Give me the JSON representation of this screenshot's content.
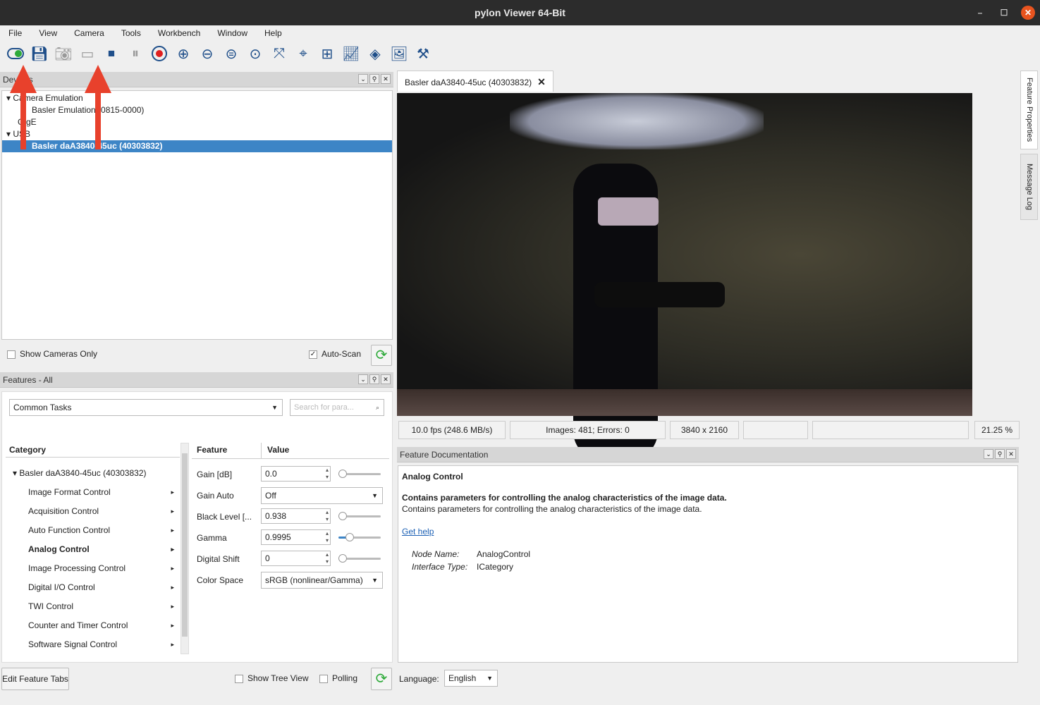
{
  "window": {
    "title": "pylon Viewer 64-Bit"
  },
  "menu": [
    "File",
    "View",
    "Camera",
    "Tools",
    "Workbench",
    "Window",
    "Help"
  ],
  "toolbar": [
    "open-camera",
    "save-features",
    "single-shot",
    "continuous-shot",
    "stop",
    "pause",
    "record",
    "zoom-in",
    "zoom-out",
    "zoom-fit",
    "zoom-100",
    "fit-window",
    "center",
    "grid",
    "histogram",
    "pixel-inspect",
    "image",
    "device-tools"
  ],
  "devices": {
    "title": "Devices",
    "tree": [
      {
        "label": "Camera Emulation",
        "level": 0,
        "expanded": true
      },
      {
        "label": "Basler Emulation (0815-0000)",
        "level": 1
      },
      {
        "label": "GigE",
        "level": 0
      },
      {
        "label": "USB",
        "level": 0,
        "expanded": true
      },
      {
        "label": "Basler daA3840-45uc (40303832)",
        "level": 1,
        "selected": true
      }
    ],
    "show_cameras_only": "Show Cameras Only",
    "auto_scan": "Auto-Scan",
    "auto_scan_checked": true
  },
  "features": {
    "title": "Features - All",
    "view_select": "Common Tasks",
    "search_placeholder": "Search for para...",
    "category_header": "Category",
    "feature_header": "Feature",
    "value_header": "Value",
    "root": "Basler daA3840-45uc (40303832)",
    "categories": [
      "Image Format Control",
      "Acquisition Control",
      "Auto Function Control",
      "Analog Control",
      "Image Processing Control",
      "Digital I/O Control",
      "TWI Control",
      "Counter and Timer Control",
      "Software Signal Control"
    ],
    "selected_category": "Analog Control",
    "rows": [
      {
        "name": "Gain [dB]",
        "value": "0.0",
        "type": "spin",
        "slider": 0.0
      },
      {
        "name": "Gain Auto",
        "value": "Off",
        "type": "combo"
      },
      {
        "name": "Black Level [...",
        "value": "0.938",
        "type": "spin",
        "slider": 0.0
      },
      {
        "name": "Gamma",
        "value": "0.9995",
        "type": "spin",
        "slider": 0.25
      },
      {
        "name": "Digital Shift",
        "value": "0",
        "type": "spin",
        "slider": 0.0
      },
      {
        "name": "Color Space",
        "value": "sRGB (nonlinear/Gamma)",
        "type": "combo"
      }
    ],
    "edit_tabs": "Edit Feature Tabs",
    "show_tree_view": "Show Tree View",
    "polling": "Polling"
  },
  "image_tab": {
    "label": "Basler daA3840-45uc (40303832)"
  },
  "status": {
    "fps": "10.0 fps (248.6 MB/s)",
    "images": "Images: 481; Errors: 0",
    "resolution": "3840 x 2160",
    "zoom": "21.25 %"
  },
  "doc": {
    "title": "Feature Documentation",
    "heading": "Analog Control",
    "summary": "Contains parameters for controlling the analog characteristics of the image data.",
    "description": "Contains parameters for controlling the analog characteristics of the image data.",
    "help_link": "Get help",
    "node_name_label": "Node Name:",
    "node_name": "AnalogControl",
    "interface_label": "Interface Type:",
    "interface": "ICategory",
    "language_label": "Language:",
    "language": "English"
  },
  "side_tabs": [
    "Feature Properties",
    "Message Log"
  ],
  "colors": {
    "selection": "#3d85c6",
    "icon": "#1f4f8a",
    "annotation_arrow": "#e8412c"
  }
}
